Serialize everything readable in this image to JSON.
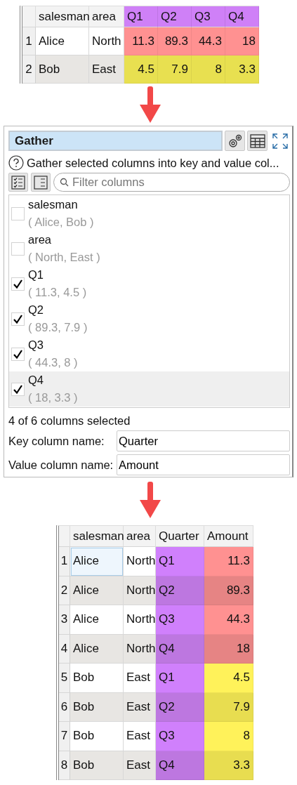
{
  "input_table": {
    "columns": [
      {
        "label": "salesman",
        "kind": "text"
      },
      {
        "label": "area",
        "kind": "text"
      },
      {
        "label": "Q1",
        "kind": "number",
        "color": "#cf80f7"
      },
      {
        "label": "Q2",
        "kind": "number",
        "color": "#cf80f7"
      },
      {
        "label": "Q3",
        "kind": "number",
        "color": "#cf80f7"
      },
      {
        "label": "Q4",
        "kind": "number",
        "color": "#cf80f7"
      }
    ],
    "rows": [
      {
        "number": "1",
        "cells": [
          {
            "text": "Alice"
          },
          {
            "text": "North"
          },
          {
            "text": "11.3",
            "color": "#ff9191"
          },
          {
            "text": "89.3",
            "color": "#ff9191"
          },
          {
            "text": "44.3",
            "color": "#ff9191"
          },
          {
            "text": "18",
            "color": "#ff9191"
          }
        ]
      },
      {
        "number": "2",
        "cells": [
          {
            "text": "Bob"
          },
          {
            "text": "East"
          },
          {
            "text": "4.5",
            "color": "#e8e050"
          },
          {
            "text": "7.9",
            "color": "#e8e050"
          },
          {
            "text": "8",
            "color": "#e8e050"
          },
          {
            "text": "3.3",
            "color": "#e8e050"
          }
        ]
      }
    ]
  },
  "transform_panel": {
    "title": "Gather",
    "description": "Gather selected columns into key and value col...",
    "filter": {
      "placeholder": "Filter columns"
    },
    "columns": [
      {
        "name": "salesman",
        "values": "( Alice, Bob )",
        "checked": false,
        "selected": false
      },
      {
        "name": "area",
        "values": "( North, East )",
        "checked": false,
        "selected": false
      },
      {
        "name": "Q1",
        "values": "( 11.3, 4.5 )",
        "checked": true,
        "selected": false
      },
      {
        "name": "Q2",
        "values": "( 89.3, 7.9 )",
        "checked": true,
        "selected": false
      },
      {
        "name": "Q3",
        "values": "( 44.3, 8 )",
        "checked": true,
        "selected": false
      },
      {
        "name": "Q4",
        "values": "( 18, 3.3 )",
        "checked": true,
        "selected": true
      }
    ],
    "status": "4 of 6 columns selected",
    "fields": [
      {
        "label": "Key column name:",
        "value": "Quarter"
      },
      {
        "label": "Value column name:",
        "value": "Amount"
      }
    ]
  },
  "output_table": {
    "columns": [
      {
        "label": "salesman",
        "kind": "text"
      },
      {
        "label": "area",
        "kind": "text"
      },
      {
        "label": "Quarter",
        "kind": "text"
      },
      {
        "label": "Amount",
        "kind": "number"
      }
    ],
    "rows": [
      {
        "number": "1",
        "cells": [
          {
            "text": "Alice",
            "selected": true
          },
          {
            "text": "North",
            "selected": false
          },
          {
            "text": "Q1",
            "color": "#d080fc",
            "selected": false
          },
          {
            "text": "11.3",
            "color": "#ff9191",
            "selected": false
          }
        ]
      },
      {
        "number": "2",
        "cells": [
          {
            "text": "Alice",
            "selected": false
          },
          {
            "text": "North",
            "selected": false
          },
          {
            "text": "Q2",
            "color": "#bd77e0",
            "selected": false
          },
          {
            "text": "89.3",
            "color": "#e68484",
            "selected": false
          }
        ]
      },
      {
        "number": "3",
        "cells": [
          {
            "text": "Alice",
            "selected": false
          },
          {
            "text": "North",
            "selected": false
          },
          {
            "text": "Q3",
            "color": "#d080fc",
            "selected": false
          },
          {
            "text": "44.3",
            "color": "#ff9191",
            "selected": false
          }
        ]
      },
      {
        "number": "4",
        "cells": [
          {
            "text": "Alice",
            "selected": false
          },
          {
            "text": "North",
            "selected": false
          },
          {
            "text": "Q4",
            "color": "#bd77e0",
            "selected": false
          },
          {
            "text": "18",
            "color": "#e68484",
            "selected": false
          }
        ]
      },
      {
        "number": "5",
        "cells": [
          {
            "text": "Bob",
            "selected": false
          },
          {
            "text": "East",
            "selected": false
          },
          {
            "text": "Q1",
            "color": "#d080fc",
            "selected": false
          },
          {
            "text": "4.5",
            "color": "#fff25a",
            "selected": false
          }
        ]
      },
      {
        "number": "6",
        "cells": [
          {
            "text": "Bob",
            "selected": false
          },
          {
            "text": "East",
            "selected": false
          },
          {
            "text": "Q2",
            "color": "#bd77e0",
            "selected": false
          },
          {
            "text": "7.9",
            "color": "#e8dd50",
            "selected": false
          }
        ]
      },
      {
        "number": "7",
        "cells": [
          {
            "text": "Bob",
            "selected": false
          },
          {
            "text": "East",
            "selected": false
          },
          {
            "text": "Q3",
            "color": "#d080fc",
            "selected": false
          },
          {
            "text": "8",
            "color": "#fff25a",
            "selected": false
          }
        ]
      },
      {
        "number": "8",
        "cells": [
          {
            "text": "Bob",
            "selected": false
          },
          {
            "text": "East",
            "selected": false
          },
          {
            "text": "Q4",
            "color": "#bd77e0",
            "selected": false
          },
          {
            "text": "3.3",
            "color": "#e8dd50",
            "selected": false
          }
        ]
      }
    ]
  }
}
